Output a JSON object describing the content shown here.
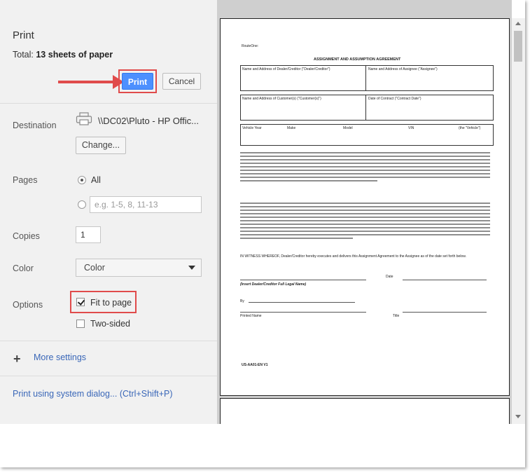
{
  "print_panel": {
    "title": "Print",
    "total_prefix": "Total: ",
    "total_value": "13 sheets of paper",
    "print_button": "Print",
    "cancel_button": "Cancel"
  },
  "destination": {
    "label": "Destination",
    "printer": "\\\\DC02\\Pluto - HP Offic...",
    "change_button": "Change..."
  },
  "pages": {
    "label": "Pages",
    "all_option": "All",
    "custom_placeholder": "e.g. 1-5, 8, 11-13"
  },
  "copies": {
    "label": "Copies",
    "value": "1"
  },
  "color": {
    "label": "Color",
    "selected": "Color"
  },
  "options": {
    "label": "Options",
    "fit_to_page": "Fit to page",
    "fit_to_page_checked": true,
    "two_sided": "Two-sided",
    "two_sided_checked": false
  },
  "more_settings": "More settings",
  "system_dialog": "Print using system dialog... (Ctrl+Shift+P)",
  "preview": {
    "heading": "ASSIGNMENT AND ASSUMPTION AGREEMENT",
    "route_label": "RouteOne:",
    "field_dealer": "Name and Address of Dealer/Creditor (\"Dealer/Creditor\")",
    "field_assignee": "Name and Address of Assignee (\"Assignee\")",
    "field_customer": "Name and Address of Customer(s) (\"Customer(s)\")",
    "field_contract_date": "Date of Contract (\"Contract Date\")",
    "vehicle_year": "Vehicle Year",
    "vehicle_make": "Make",
    "vehicle_model": "Model",
    "vehicle_vin": "VIN",
    "vehicle_label": "(the \"Vehicle\")",
    "witness": "IN WITNESS WHEREOF, Dealer/Creditor hereby executes and delivers this Assignment Agreement to the Assignee as of the date set forth below.",
    "date_label": "Date",
    "insert_name": "(Insert Dealer/Creditor Full Legal Name)",
    "by_label": "By",
    "printed_name": "Printed Name",
    "title_label": "Title",
    "form_code": "US-AA01-EN V1"
  },
  "colors": {
    "accent": "#4d90fe",
    "highlight": "#e04b4b",
    "link": "#3a67b8"
  }
}
